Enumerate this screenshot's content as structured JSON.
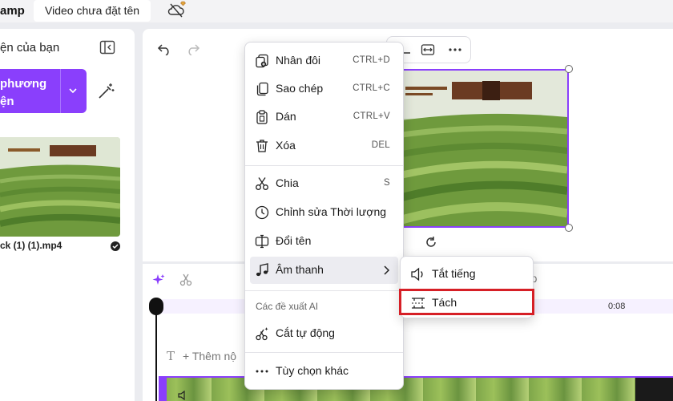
{
  "app": {
    "name": "amp",
    "video_title": "Video chưa đặt tên"
  },
  "media_panel": {
    "title": "ện của bạn",
    "import_button": "phương ện",
    "clip_name": "ck (1) (1).mp4"
  },
  "timeline": {
    "time_mid": "0",
    "time_end": "0:08",
    "text_track_placeholder": "+ Thêm nộ"
  },
  "context_menu": {
    "items": [
      {
        "icon": "duplicate-icon",
        "label": "Nhân đôi",
        "shortcut": "CTRL+D"
      },
      {
        "icon": "copy-icon",
        "label": "Sao chép",
        "shortcut": "CTRL+C"
      },
      {
        "icon": "paste-icon",
        "label": "Dán",
        "shortcut": "CTRL+V"
      },
      {
        "icon": "trash-icon",
        "label": "Xóa",
        "shortcut": "DEL"
      },
      {
        "icon": "scissors-icon",
        "label": "Chia",
        "shortcut": "S"
      },
      {
        "icon": "clock-icon",
        "label": "Chỉnh sửa Thời lượng",
        "shortcut": ""
      },
      {
        "icon": "rename-icon",
        "label": "Đổi tên",
        "shortcut": ""
      },
      {
        "icon": "music-note-icon",
        "label": "Âm thanh",
        "shortcut": ""
      },
      {
        "icon": "magic-scissors-icon",
        "label": "Cắt tự động",
        "shortcut": ""
      },
      {
        "icon": "more-icon",
        "label": "Tùy chọn khác",
        "shortcut": ""
      }
    ],
    "ai_section_label": "Các đề xuất AI"
  },
  "audio_submenu": {
    "items": [
      {
        "icon": "mute-icon",
        "label": "Tắt tiếng"
      },
      {
        "icon": "split-audio-icon",
        "label": "Tách"
      }
    ]
  },
  "colors": {
    "accent": "#8a3ffc",
    "highlight": "#d61f26"
  }
}
